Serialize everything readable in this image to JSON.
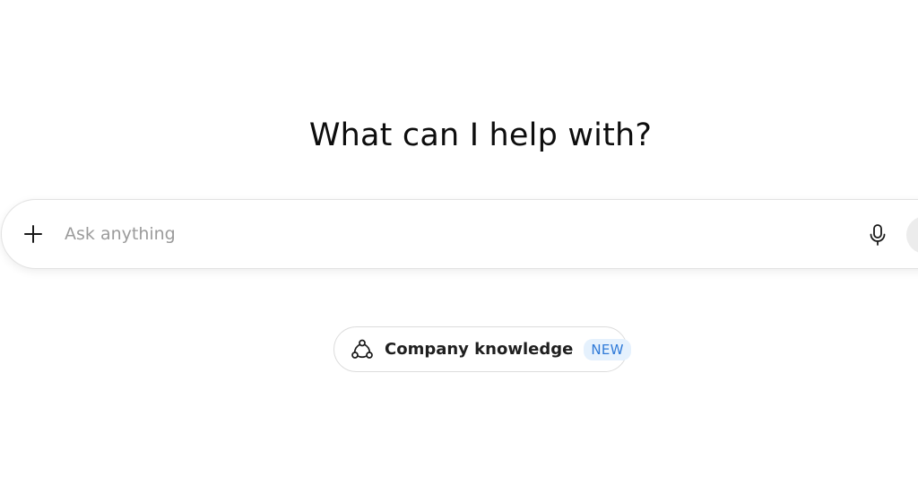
{
  "main": {
    "heading": "What can I help with?"
  },
  "composer": {
    "placeholder": "Ask anything",
    "value": "",
    "icons": {
      "attach": "plus-icon",
      "dictate": "microphone-icon"
    }
  },
  "suggestion": {
    "label": "Company knowledge",
    "badge": "NEW",
    "icon": "connected-nodes-icon"
  },
  "colors": {
    "background": "#ffffff",
    "text": "#0d0d0d",
    "placeholder": "#9b9b9b",
    "badge_bg": "#e5f1fd",
    "badge_text": "#2f7ad8",
    "border": "#e3e3e3"
  }
}
